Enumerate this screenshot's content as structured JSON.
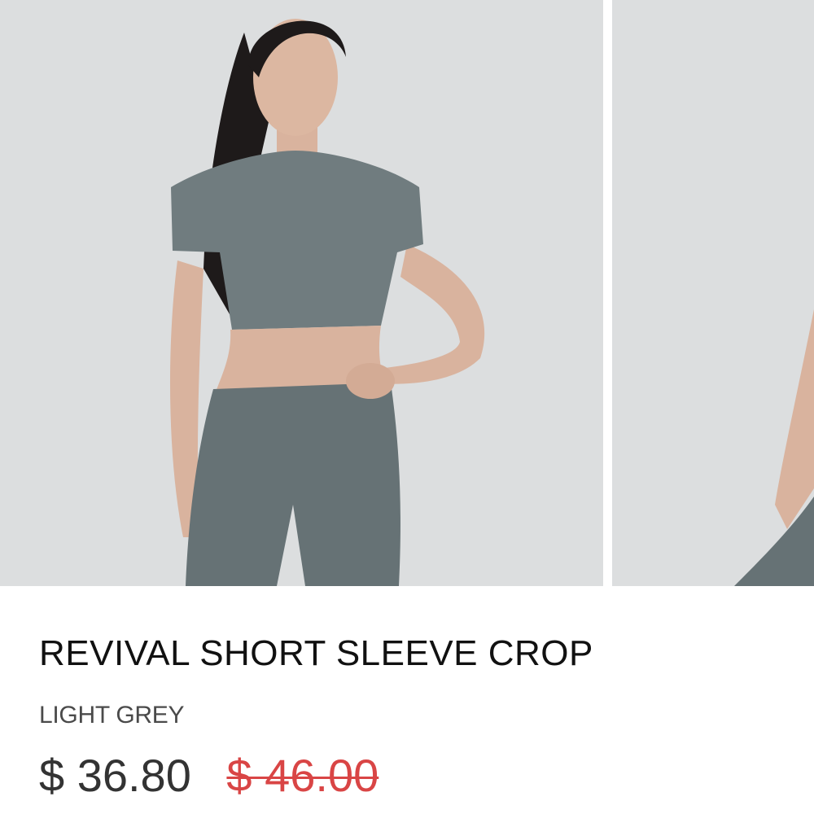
{
  "product": {
    "title": "REVIVAL SHORT SLEEVE CROP",
    "color_variant": "LIGHT GREY",
    "price_current": "$ 36.80",
    "price_original": "$ 46.00"
  },
  "gallery": {
    "images": [
      {
        "description_icon": "model-front-photo"
      },
      {
        "description_icon": "model-side-photo"
      }
    ]
  },
  "colors": {
    "sale_price": "#d94545",
    "garment": "#6f7b7e",
    "background": "#dcdedf"
  }
}
